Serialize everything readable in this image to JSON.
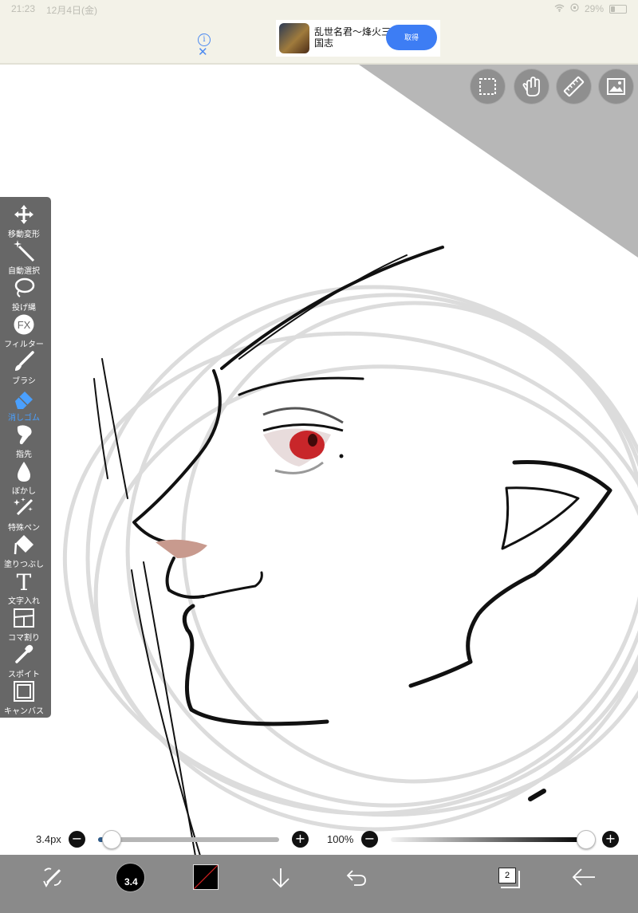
{
  "status_bar": {
    "time": "21:23",
    "date": "12月4日(金)",
    "battery": "29%",
    "battery_level": 0.29
  },
  "ad": {
    "title": "乱世名君〜烽火三国志",
    "button_label": "取得",
    "info_icon": "info-icon",
    "close_icon": "close-icon"
  },
  "top_tools": [
    {
      "name": "selection-tool",
      "icon": "dashed-square-icon"
    },
    {
      "name": "hand-tool",
      "icon": "hand-icon"
    },
    {
      "name": "ruler-tool",
      "icon": "ruler-icon"
    },
    {
      "name": "material-tool",
      "icon": "image-icon"
    }
  ],
  "toolbar": {
    "items": [
      {
        "label": "移動変形",
        "icon": "move-arrows-icon"
      },
      {
        "label": "自動選択",
        "icon": "magic-wand-icon"
      },
      {
        "label": "投げ縄",
        "icon": "lasso-icon"
      },
      {
        "label": "フィルター",
        "icon": "fx-icon"
      },
      {
        "label": "ブラシ",
        "icon": "brush-icon"
      },
      {
        "label": "消しゴム",
        "icon": "eraser-icon",
        "active": true
      },
      {
        "label": "指先",
        "icon": "finger-icon"
      },
      {
        "label": "ぼかし",
        "icon": "blur-drop-icon"
      },
      {
        "label": "特殊ペン",
        "icon": "special-pen-icon"
      },
      {
        "label": "塗りつぶし",
        "icon": "bucket-icon"
      },
      {
        "label": "文字入れ",
        "icon": "text-icon"
      },
      {
        "label": "コマ割り",
        "icon": "panel-icon"
      },
      {
        "label": "スポイト",
        "icon": "eyedropper-icon"
      },
      {
        "label": "キャンバス",
        "icon": "canvas-icon"
      }
    ]
  },
  "brush_size": {
    "label": "3.4px",
    "value_fraction": 0.07
  },
  "opacity": {
    "label": "100%",
    "value_fraction": 1.0
  },
  "bottom_bar": {
    "brush_size_text": "3.4",
    "layer_count": "2",
    "icons": [
      "transform-icon",
      "brush-size-icon",
      "color-swatch-icon",
      "down-arrow-icon",
      "undo-icon",
      "layers-icon",
      "back-arrow-icon"
    ]
  },
  "colors": {
    "toolbar_bg": "#676767",
    "active_tool": "#4aa0ff",
    "ad_button": "#3d7df4",
    "iris": "#c8262a",
    "nose_blush": "#c89a8e"
  }
}
